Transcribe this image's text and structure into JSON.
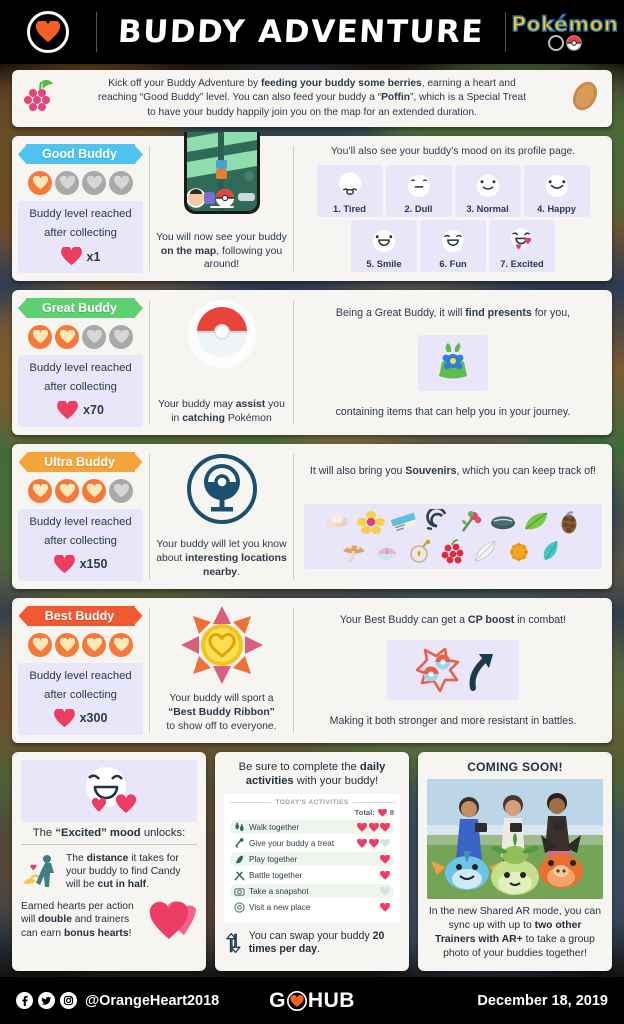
{
  "header": {
    "title": "Buddy Adventure",
    "logo_icon": "heart-logo-icon",
    "brand_word": "Pokémon",
    "brand_go": "GO"
  },
  "intro": {
    "berry_icon": "berries-icon",
    "poffin_icon": "poffin-icon",
    "line1_a": "Kick off your Buddy Adventure by ",
    "line1_b": "feeding your buddy some berries",
    "line1_c": ", earning a heart and",
    "line2_a": "reaching “Good Buddy” level. You can also feed your buddy a “",
    "line2_b": "Poffin",
    "line2_c": "”, which is a Special Treat",
    "line3": "to have your buddy happily join you on the map for an extended duration."
  },
  "levels": [
    {
      "name": "Good Buddy",
      "ribbon_color": "#4EC3F0",
      "hearts_filled": 1,
      "hearts_total": 4,
      "reach_text_l1": "Buddy level reached",
      "reach_text_l2": "after collecting",
      "count": "x1",
      "mid_icon": "phone-map-screenshot",
      "mid_cap_a": "You will now see your buddy ",
      "mid_cap_b": "on the map",
      "mid_cap_c": ", following you around!"
    },
    {
      "name": "Great Buddy",
      "ribbon_color": "#5FD072",
      "hearts_filled": 2,
      "hearts_total": 4,
      "reach_text_l1": "Buddy level reached",
      "reach_text_l2": "after collecting",
      "count": "x70",
      "mid_icon": "pokeball-icon",
      "mid_cap_a": "Your buddy may ",
      "mid_cap_b": "assist",
      "mid_cap_c": " you in ",
      "mid_cap_d": "catching",
      "mid_cap_e": " Pokémon",
      "right_top_a": "Being a Great Buddy, it will ",
      "right_top_b": "find presents",
      "right_top_c": " for you,",
      "right_icon": "present-bag-icon",
      "right_bottom": "containing items that can help you in your journey."
    },
    {
      "name": "Ultra Buddy",
      "ribbon_color": "#F5A43C",
      "hearts_filled": 3,
      "hearts_total": 4,
      "reach_text_l1": "Buddy level reached",
      "reach_text_l2": "after collecting",
      "count": "x150",
      "mid_icon": "pokestop-icon",
      "mid_cap_a": "Your buddy will let you know about ",
      "mid_cap_b": "interesting locations nearby",
      "mid_cap_c": ".",
      "right_top_a": "It will also bring you ",
      "right_top_b": "Souvenirs",
      "right_top_c": ", which you can keep track of!"
    },
    {
      "name": "Best Buddy",
      "ribbon_color": "#F15A31",
      "hearts_filled": 4,
      "hearts_total": 4,
      "reach_text_l1": "Buddy level reached",
      "reach_text_l2": "after collecting",
      "count": "x300",
      "mid_icon": "best-buddy-ribbon-icon",
      "mid_cap_a": "Your buddy will sport a",
      "mid_cap_b": "“Best Buddy Ribbon”",
      "mid_cap_c": "to show off to everyone.",
      "right_top_a": "Your Best Buddy can get a ",
      "right_top_b": "CP boost",
      "right_top_c": " in combat!",
      "right_icon": "cp-boost-icon",
      "right_bottom": "Making it both stronger and more resistant in battles."
    }
  ],
  "moods": {
    "heading": "You’ll also see your buddy’s mood on its profile page.",
    "items": [
      {
        "label": "1. Tired",
        "icon": "mood-tired-icon"
      },
      {
        "label": "2. Dull",
        "icon": "mood-dull-icon"
      },
      {
        "label": "3. Normal",
        "icon": "mood-normal-icon"
      },
      {
        "label": "4. Happy",
        "icon": "mood-happy-icon"
      },
      {
        "label": "5. Smile",
        "icon": "mood-smile-icon"
      },
      {
        "label": "6. Fun",
        "icon": "mood-fun-icon"
      },
      {
        "label": "7. Excited",
        "icon": "mood-excited-icon"
      }
    ]
  },
  "souvenirs": {
    "row1": [
      "seashells-icon",
      "flower-icon",
      "postcard-icon",
      "spiral-shell-icon",
      "flower-bud-icon",
      "stone-icon",
      "leaf-icon",
      "pinecone-icon"
    ],
    "row2": [
      "mushroom-icon",
      "shell-icon",
      "compass-icon",
      "berries-cluster-icon",
      "feather-icon",
      "spiky-fruit-icon",
      "gem-icon"
    ]
  },
  "excited_card": {
    "face_icon": "mood-excited-icon",
    "title_a": "The ",
    "title_b": "“Excited” mood",
    "title_c": " unlocks:",
    "item1_icon": "walking-trainer-icon",
    "item1_a": "The ",
    "item1_b": "distance",
    "item1_c": " it takes for your buddy to find Candy will be ",
    "item1_d": "cut in half",
    "item1_e": ".",
    "item2_a": "Earned hearts per action will ",
    "item2_b": "double",
    "item2_c": " and trainers can earn ",
    "item2_d": "bonus hearts",
    "item2_e": "!",
    "item2_icon": "double-hearts-icon"
  },
  "activities_card": {
    "title_a": "Be sure to complete the ",
    "title_b": "daily activities",
    "title_c": " with your buddy!",
    "panel_header": "TODAY'S ACTIVITIES",
    "total_label": "Total:",
    "total_value": "8",
    "rows": [
      {
        "name": "Walk together",
        "icon": "footprints-icon",
        "hearts_filled": 3,
        "hearts_empty": 0
      },
      {
        "name": "Give your buddy a treat",
        "icon": "treat-icon",
        "hearts_filled": 2,
        "hearts_empty": 1
      },
      {
        "name": "Play together",
        "icon": "play-icon",
        "hearts_filled": 1,
        "hearts_empty": 0
      },
      {
        "name": "Battle together",
        "icon": "battle-icon",
        "hearts_filled": 1,
        "hearts_empty": 0
      },
      {
        "name": "Take a snapshot",
        "icon": "camera-icon",
        "hearts_filled": 0,
        "hearts_empty": 1
      },
      {
        "name": "Visit a new place",
        "icon": "pokestop-small-icon",
        "hearts_filled": 1,
        "hearts_empty": 0
      }
    ],
    "swap_icon": "swap-arrows-icon",
    "swap_a": "You can swap your buddy ",
    "swap_b": "20 times per day",
    "swap_c": "."
  },
  "coming_soon": {
    "title": "COMING SOON!",
    "image_icon": "shared-ar-photo",
    "text_a": "In the new Shared AR mode, you can sync up with up to ",
    "text_b": "two other Trainers with AR+",
    "text_c": " to take a group photo of your buddies together!"
  },
  "footer": {
    "facebook_icon": "facebook-icon",
    "twitter_icon": "twitter-icon",
    "instagram_icon": "instagram-icon",
    "handle": "@OrangeHeart2018",
    "brand_a": "G",
    "brand_b": "HUB",
    "brand_icon": "heart-logo-icon",
    "date": "December 18, 2019"
  },
  "colors": {
    "accent_orange": "#F4793B",
    "heart_pink": "#EE3D62",
    "good": "#4EC3F0",
    "great": "#5FD072",
    "ultra": "#F5A43C",
    "best": "#F15A31",
    "card_bg": "#F7F5F2",
    "tile_bg": "#E8E6F8"
  }
}
